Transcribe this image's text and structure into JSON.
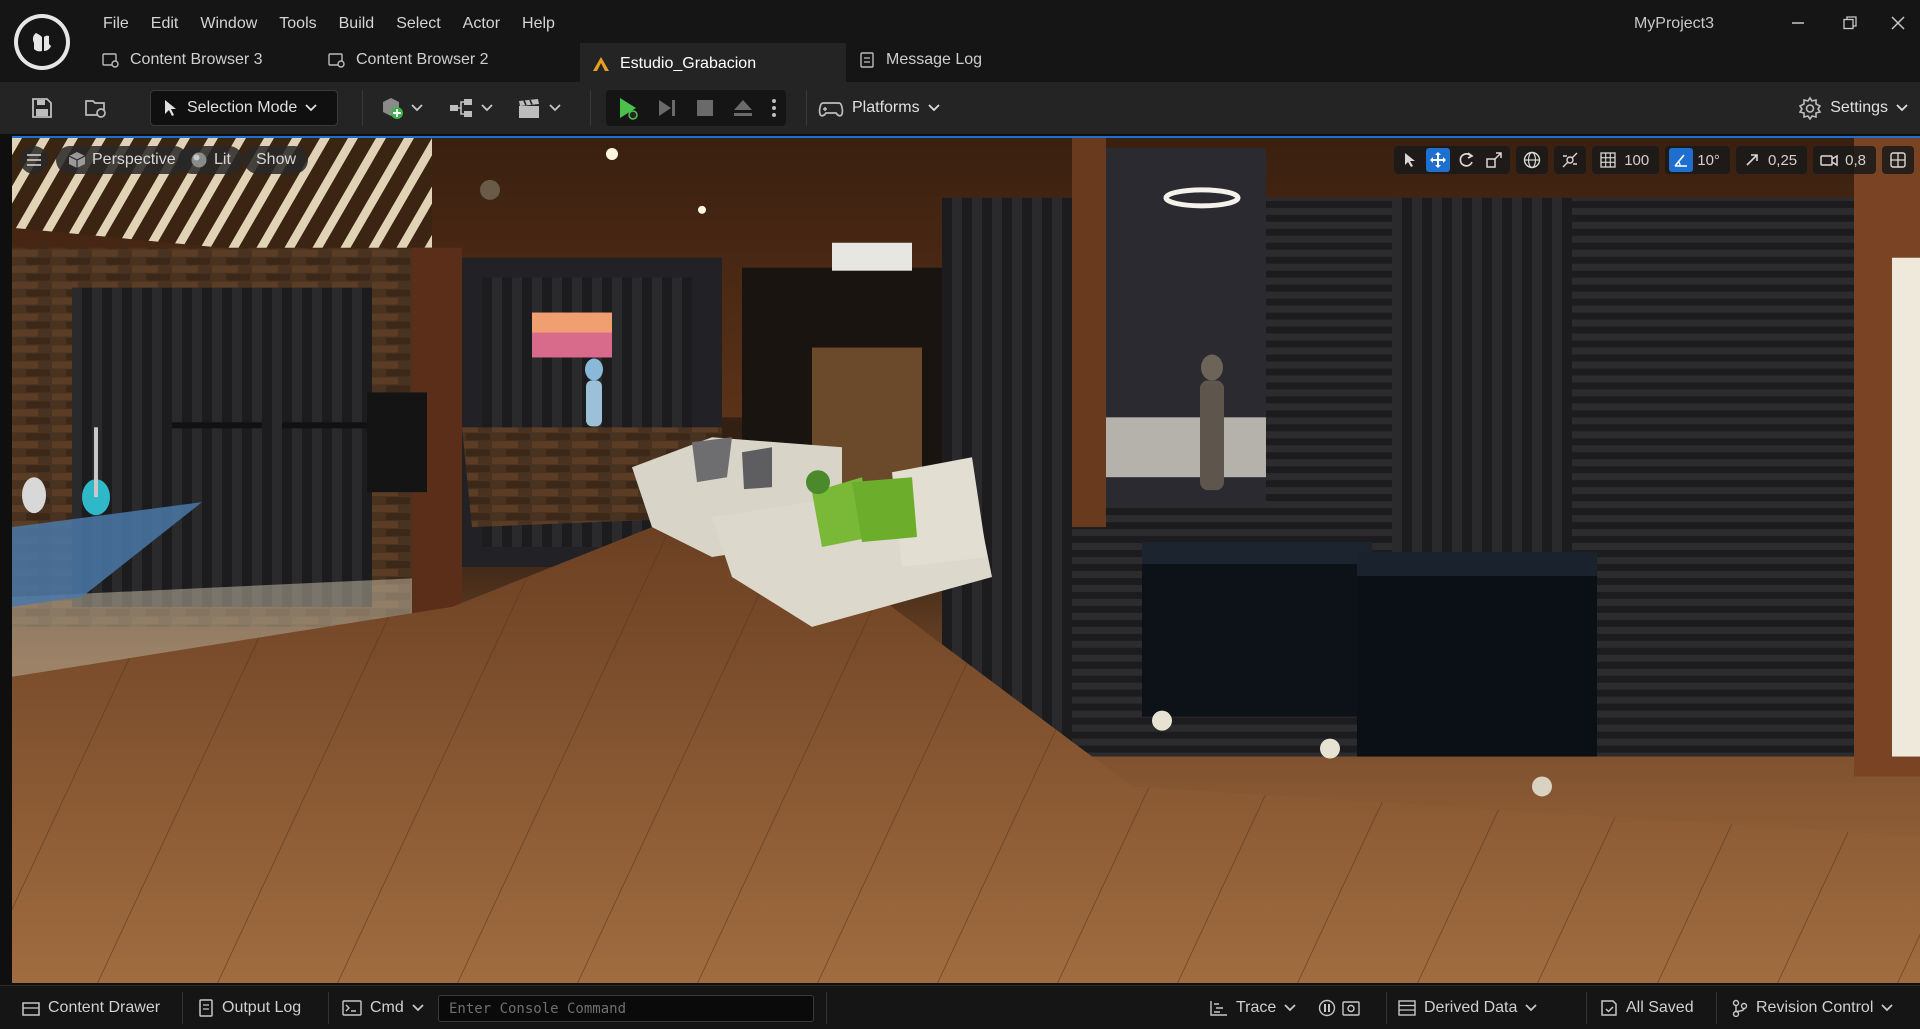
{
  "app": {
    "project_name": "MyProject3"
  },
  "menu": [
    "File",
    "Edit",
    "Window",
    "Tools",
    "Build",
    "Select",
    "Actor",
    "Help"
  ],
  "tabs": [
    {
      "label": "Content Browser 3",
      "icon": "content-browser-icon",
      "active": false
    },
    {
      "label": "Content Browser 2",
      "icon": "content-browser-icon",
      "active": false
    },
    {
      "label": "Estudio_Grabacion",
      "icon": "level-icon",
      "active": true
    },
    {
      "label": "Message Log",
      "icon": "message-log-icon",
      "active": false
    }
  ],
  "toolbar": {
    "selection_mode": "Selection Mode",
    "platforms": "Platforms",
    "settings": "Settings"
  },
  "viewport": {
    "perspective": "Perspective",
    "lit": "Lit",
    "show": "Show",
    "grid_snap": "100",
    "rotation_snap": "10°",
    "scale_snap": "0,25",
    "camera_speed": "0,8"
  },
  "statusbar": {
    "content_drawer": "Content Drawer",
    "output_log": "Output Log",
    "cmd": "Cmd",
    "console_placeholder": "Enter Console Command",
    "trace": "Trace",
    "derived_data": "Derived Data",
    "all_saved": "All Saved",
    "revision_control": "Revision Control"
  },
  "colors": {
    "accent": "#1f6fd1",
    "play_green": "#4cc04c",
    "background": "#151515",
    "panel": "#242424"
  }
}
